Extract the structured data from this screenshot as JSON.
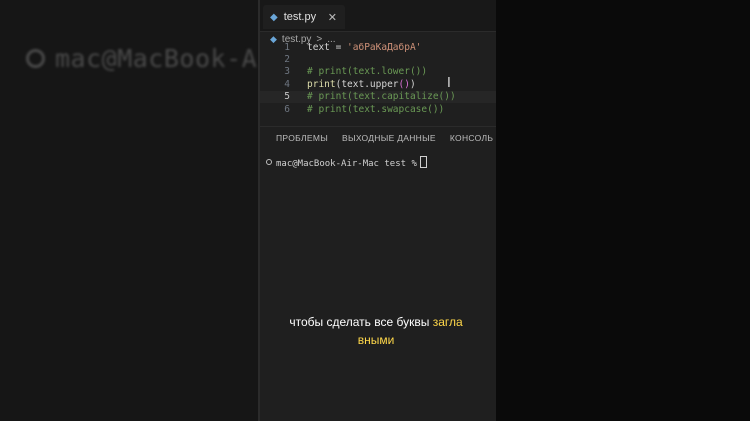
{
  "background": {
    "prompt_text": "mac@MacBook-Ai"
  },
  "editor": {
    "tab": {
      "filename": "test.py",
      "close_symbol": "✕",
      "icon": "python-file-icon"
    },
    "breadcrumb": {
      "file": "test.py",
      "separator": ">",
      "more": "..."
    },
    "lines": [
      {
        "num": "1",
        "tokens": [
          {
            "t": "text = ",
            "c": ""
          },
          {
            "t": "'абРаКаДабрА'",
            "c": "str"
          }
        ]
      },
      {
        "num": "2",
        "tokens": []
      },
      {
        "num": "3",
        "tokens": [
          {
            "t": "# print(text.lower())",
            "c": "cm"
          }
        ]
      },
      {
        "num": "4",
        "tokens": [
          {
            "t": "print",
            "c": "kw"
          },
          {
            "t": "(text.upper",
            "c": ""
          },
          {
            "t": "()",
            "c": "br1"
          },
          {
            "t": ")",
            "c": ""
          }
        ]
      },
      {
        "num": "5",
        "tokens": [
          {
            "t": "# print(text.capitalize())",
            "c": "cm"
          }
        ]
      },
      {
        "num": "6",
        "tokens": [
          {
            "t": "# print(text.swapcase())",
            "c": "cm"
          }
        ]
      }
    ],
    "panel_tabs": [
      "ПРОБЛЕМЫ",
      "ВЫХОДНЫЕ ДАННЫЕ",
      "КОНСОЛЬ ОТЛА"
    ],
    "terminal_prompt": "mac@MacBook-Air-Mac test %"
  },
  "caption": {
    "part1": "чтобы сделать все буквы ",
    "highlight1": "загла",
    "highlight2": "вными",
    "highlight_color": "#ffd84a"
  }
}
